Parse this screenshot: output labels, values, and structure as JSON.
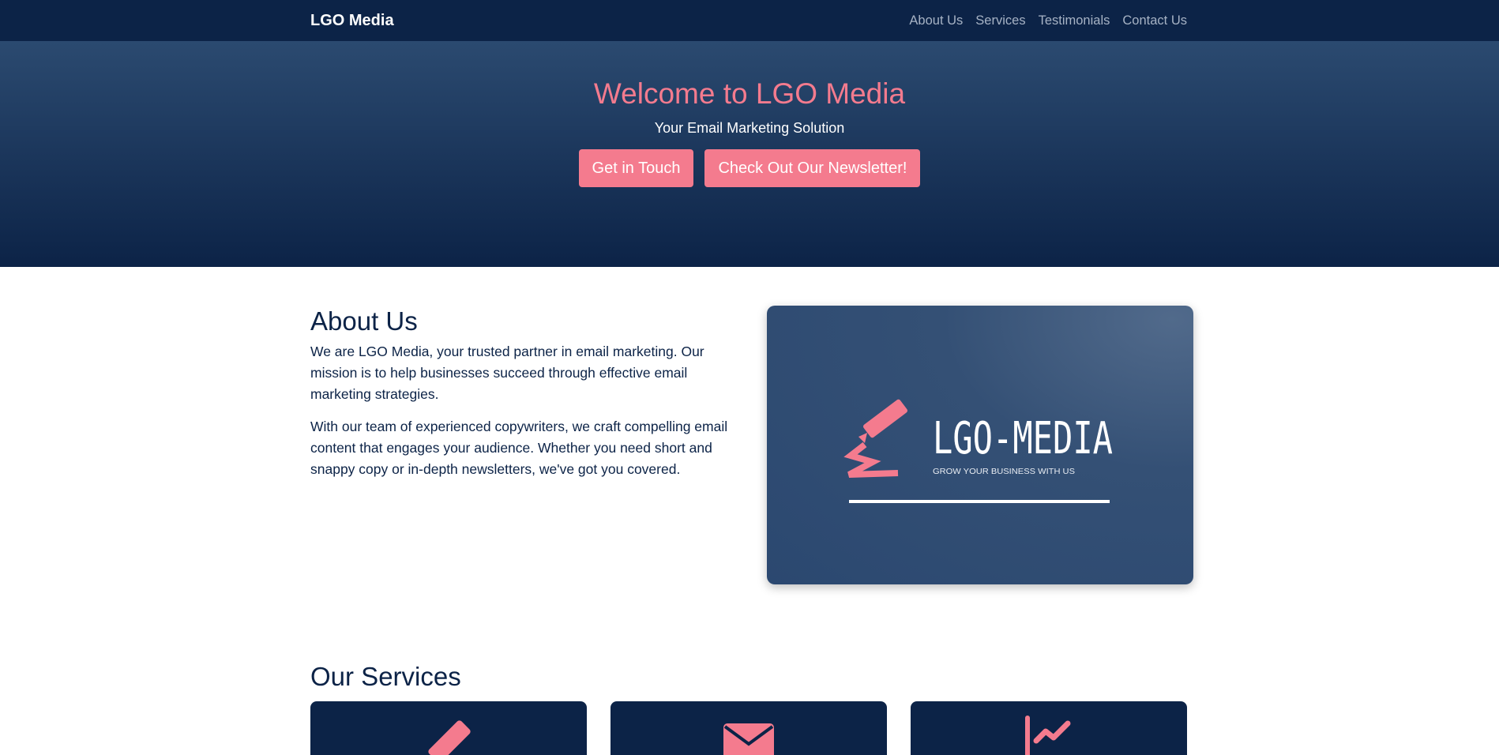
{
  "navbar": {
    "brand": "LGO Media",
    "links": [
      "About Us",
      "Services",
      "Testimonials",
      "Contact Us"
    ]
  },
  "hero": {
    "title": "Welcome to LGO Media",
    "subtitle": "Your Email Marketing Solution",
    "buttons": [
      "Get in Touch",
      "Check Out Our Newsletter!"
    ]
  },
  "about": {
    "title": "About Us",
    "paragraphs": [
      "We are LGO Media, your trusted partner in email marketing. Our mission is to help businesses succeed through effective email marketing strategies.",
      "With our team of experienced copywriters, we craft compelling email content that engages your audience. Whether you need short and snappy copy or in-depth newsletters, we've got you covered."
    ],
    "logo": {
      "wordmark": "LGO-MEDIA",
      "tagline": "GROW YOUR BUSINESS WITH US"
    }
  },
  "services": {
    "title": "Our Services",
    "icons": [
      "pencil-icon",
      "envelope-icon",
      "chart-line-icon"
    ]
  },
  "colors": {
    "navy": "#0c2347",
    "accent": "#f47b8e",
    "nav_link": "#a6b2c4"
  }
}
